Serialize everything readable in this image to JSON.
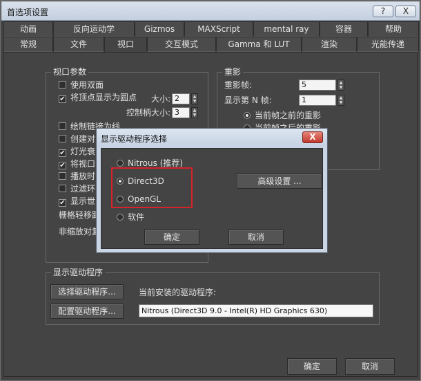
{
  "window": {
    "title": "首选项设置",
    "help_label": "?",
    "close_label": "X"
  },
  "tabs_row1": [
    "动画",
    "反向运动学",
    "Gizmos",
    "MAXScript",
    "mental ray",
    "容器",
    "帮助"
  ],
  "tabs_row2": [
    "常规",
    "文件",
    "视口",
    "交互模式",
    "Gamma 和 LUT",
    "渲染",
    "光能传递"
  ],
  "active_tab": "视口",
  "viewport_params": {
    "title": "视口参数",
    "use_double_sided": "使用双面",
    "show_verts_as_dots": "将顶点显示为圆点",
    "size_label": "大小:",
    "size_value": "2",
    "handle_size_label": "控制柄大小:",
    "handle_size_value": "3",
    "items": [
      {
        "label": "绘制链接为线",
        "checked": false
      },
      {
        "label": "创建对",
        "checked": false
      },
      {
        "label": "灯光衰",
        "checked": true
      },
      {
        "label": "将视口",
        "checked": true
      },
      {
        "label": "播放时",
        "checked": false
      },
      {
        "label": "过滤环",
        "checked": false
      },
      {
        "label": "显示世",
        "checked": true
      }
    ],
    "grid_nudge": "栅格轻移距",
    "non_scale": "非缩放对复"
  },
  "ghosting": {
    "title": "重影",
    "frames_label": "重影帧:",
    "frames_value": "5",
    "nth_label": "显示第 N 帧:",
    "nth_value": "1",
    "before": "当前帧之前的重影",
    "after": "当前帧之后的重影"
  },
  "display_drivers": {
    "title": "显示驱动程序",
    "choose_button": "选择驱动程序...",
    "configure_button": "配置驱动程序...",
    "installed_label": "当前安装的驱动程序:",
    "installed_value": "Nitrous (Direct3D 9.0 - Intel(R) HD Graphics 630)"
  },
  "footer": {
    "ok": "确定",
    "cancel": "取消"
  },
  "modal": {
    "title": "显示驱动程序选择",
    "close_label": "X",
    "options": [
      {
        "label": "Nitrous (推荐)",
        "selected": false
      },
      {
        "label": "Direct3D",
        "selected": true
      },
      {
        "label": "OpenGL",
        "selected": false
      },
      {
        "label": "软件",
        "selected": false
      }
    ],
    "advanced_button": "高级设置 ...",
    "ok": "确定",
    "cancel": "取消",
    "highlight_color": "#d6232a"
  }
}
